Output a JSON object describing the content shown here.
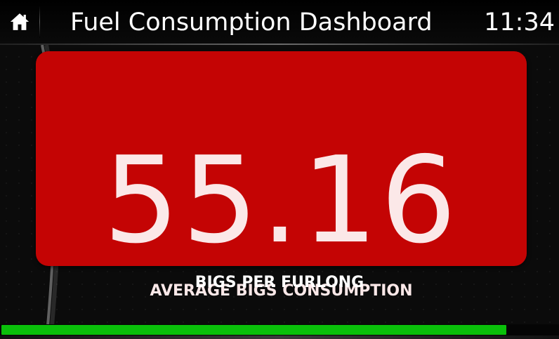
{
  "header": {
    "home_icon": "home-icon",
    "title": "Fuel Consumption Dashboard",
    "clock": "11:34"
  },
  "metric": {
    "value": "55.16",
    "label": "AVERAGE BIGS CONSUMPTION",
    "unit": "BIGS PER FURLONG"
  },
  "progress": {
    "fraction": 0.905,
    "color": "#0ac00a"
  },
  "colors": {
    "card": "#c40404",
    "background": "#0b0b0b"
  }
}
